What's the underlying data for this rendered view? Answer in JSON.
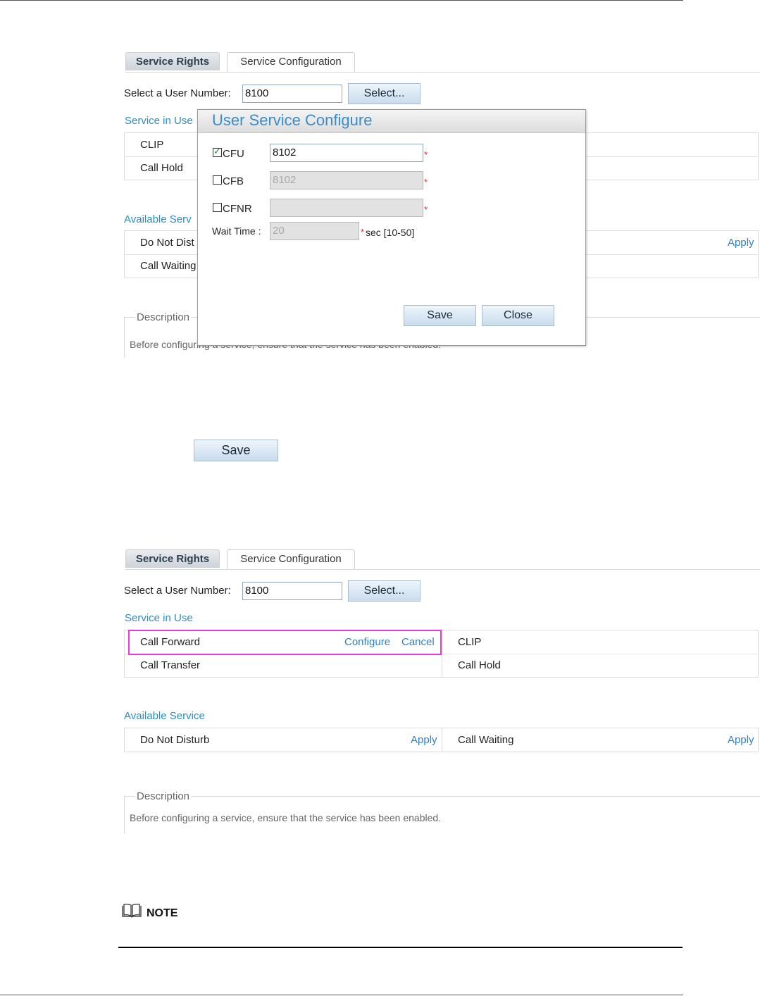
{
  "screenshot1": {
    "tabs": [
      "Service Rights",
      "Service Configuration"
    ],
    "select_label": "Select a User Number:",
    "user_number": "8100",
    "select_button": "Select...",
    "service_in_use_title": "Service in Use",
    "service_in_use_rows": [
      "CLIP",
      "Call Hold"
    ],
    "available_title": "Available Serv",
    "available_rows": [
      "Do Not Dist",
      "Call Waiting"
    ],
    "apply_label": "Apply",
    "description_legend": "Description",
    "description_text": "Before configuring a service, ensure that the service has been enabled."
  },
  "dialog": {
    "title": "User Service Configure",
    "cfu_label": "CFU",
    "cfu_checked": true,
    "cfu_value": "8102",
    "cfb_label": "CFB",
    "cfb_checked": false,
    "cfb_value": "8102",
    "cfnr_label": "CFNR",
    "cfnr_checked": false,
    "cfnr_value": "",
    "wait_time_label": "Wait Time :",
    "wait_time_value": "20",
    "required_mark": "*",
    "wait_time_hint": "sec [10-50]",
    "save_label": "Save",
    "close_label": "Close"
  },
  "standalone_save": "Save",
  "screenshot2": {
    "tabs": [
      "Service Rights",
      "Service Configuration"
    ],
    "select_label": "Select a User Number:",
    "user_number": "8100",
    "select_button": "Select...",
    "service_in_use_title": "Service in Use",
    "in_use": [
      {
        "left": "Call Forward",
        "configure": "Configure",
        "cancel": "Cancel",
        "right": "CLIP"
      },
      {
        "left": "Call Transfer",
        "right": "Call Hold"
      }
    ],
    "available_title": "Available Service",
    "available": {
      "left": "Do Not Disturb",
      "left_action": "Apply",
      "right": "Call Waiting",
      "right_action": "Apply"
    },
    "description_legend": "Description",
    "description_text": "Before configuring a service, ensure that the service has been enabled."
  },
  "note_label": "NOTE",
  "colors": {
    "accent": "#2e8bc0",
    "highlight": "#e83ad8",
    "required": "#e03030"
  }
}
